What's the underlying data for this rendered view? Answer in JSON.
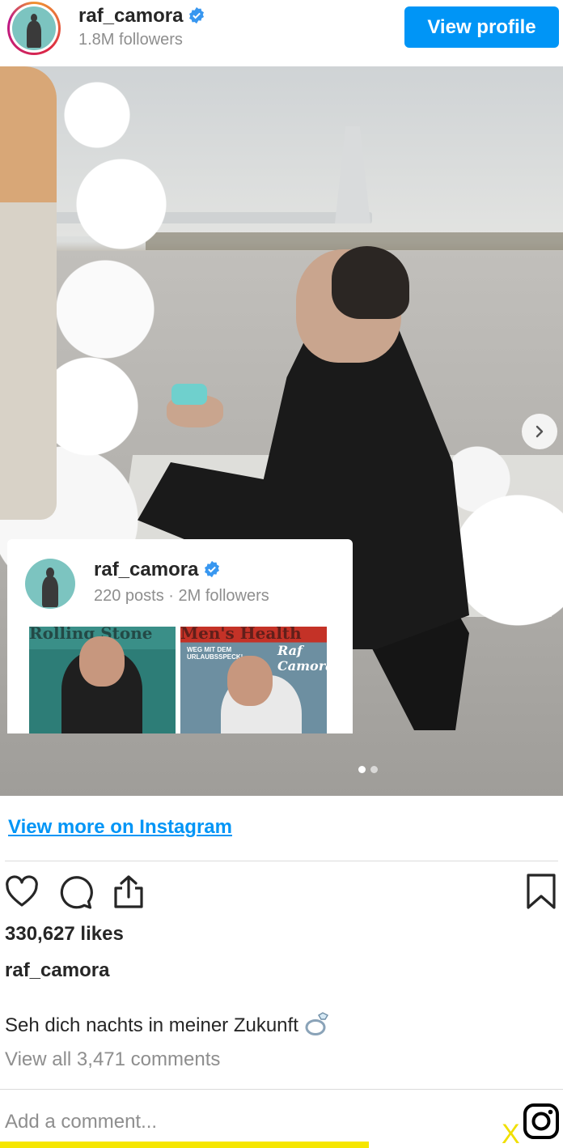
{
  "header": {
    "username": "raf_camora",
    "followers": "1.8M followers",
    "view_profile_label": "View profile"
  },
  "colors": {
    "accent": "#0095f6",
    "text": "#262626",
    "muted": "#8e8e8e",
    "ad_bar": "#f6e600"
  },
  "carousel": {
    "current_slide": 1,
    "total_slides": 2
  },
  "profile_card": {
    "username": "raf_camora",
    "meta": "220 posts · 2M followers",
    "thumbnails": [
      {
        "title": "Rolling Stone",
        "subtitle": ""
      },
      {
        "title": "Men's Health",
        "subtitle": "WEG MIT DEM URLAUBSSPECK!",
        "brand": "Raf Camora"
      }
    ]
  },
  "post": {
    "view_more_label": "View more on Instagram",
    "likes": "330,627 likes",
    "owner": "raf_camora",
    "caption": "Seh dich nachts in meiner Zukunft",
    "caption_emoji": "ring",
    "view_comments": "View all 3,471 comments",
    "comment_placeholder": "Add a comment..."
  },
  "icons": [
    "verified-icon",
    "heart-icon",
    "comment-icon",
    "share-icon",
    "bookmark-icon",
    "chevron-right-icon",
    "instagram-icon",
    "close-icon"
  ],
  "ad": {
    "close_label": "X"
  }
}
